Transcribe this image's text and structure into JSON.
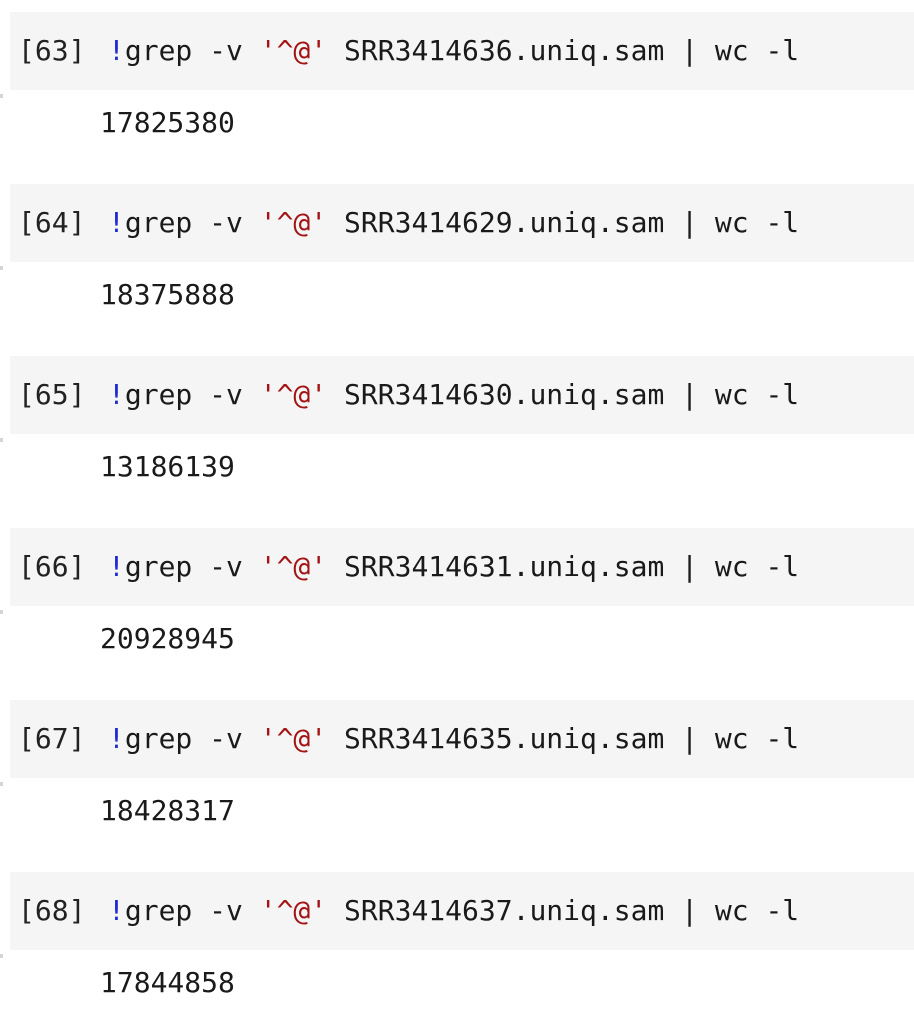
{
  "cells": [
    {
      "prompt": "[63]",
      "bang": "!",
      "cmd_before": "grep -v ",
      "pattern": "'^@'",
      "cmd_after": " SRR3414636.uniq.sam | wc -l",
      "output": "17825380"
    },
    {
      "prompt": "[64]",
      "bang": "!",
      "cmd_before": "grep -v ",
      "pattern": "'^@'",
      "cmd_after": " SRR3414629.uniq.sam | wc -l",
      "output": "18375888"
    },
    {
      "prompt": "[65]",
      "bang": "!",
      "cmd_before": "grep -v ",
      "pattern": "'^@'",
      "cmd_after": " SRR3414630.uniq.sam | wc -l",
      "output": "13186139"
    },
    {
      "prompt": "[66]",
      "bang": "!",
      "cmd_before": "grep -v ",
      "pattern": "'^@'",
      "cmd_after": " SRR3414631.uniq.sam | wc -l",
      "output": "20928945"
    },
    {
      "prompt": "[67]",
      "bang": "!",
      "cmd_before": "grep -v ",
      "pattern": "'^@'",
      "cmd_after": " SRR3414635.uniq.sam | wc -l",
      "output": "18428317"
    },
    {
      "prompt": "[68]",
      "bang": "!",
      "cmd_before": "grep -v ",
      "pattern": "'^@'",
      "cmd_after": " SRR3414637.uniq.sam | wc -l",
      "output": "17844858"
    }
  ],
  "colors": {
    "cell_background": "#f5f5f5",
    "shell_bang": "#1a2bd1",
    "string_literal": "#a31515",
    "text": "#1a1a1a"
  }
}
